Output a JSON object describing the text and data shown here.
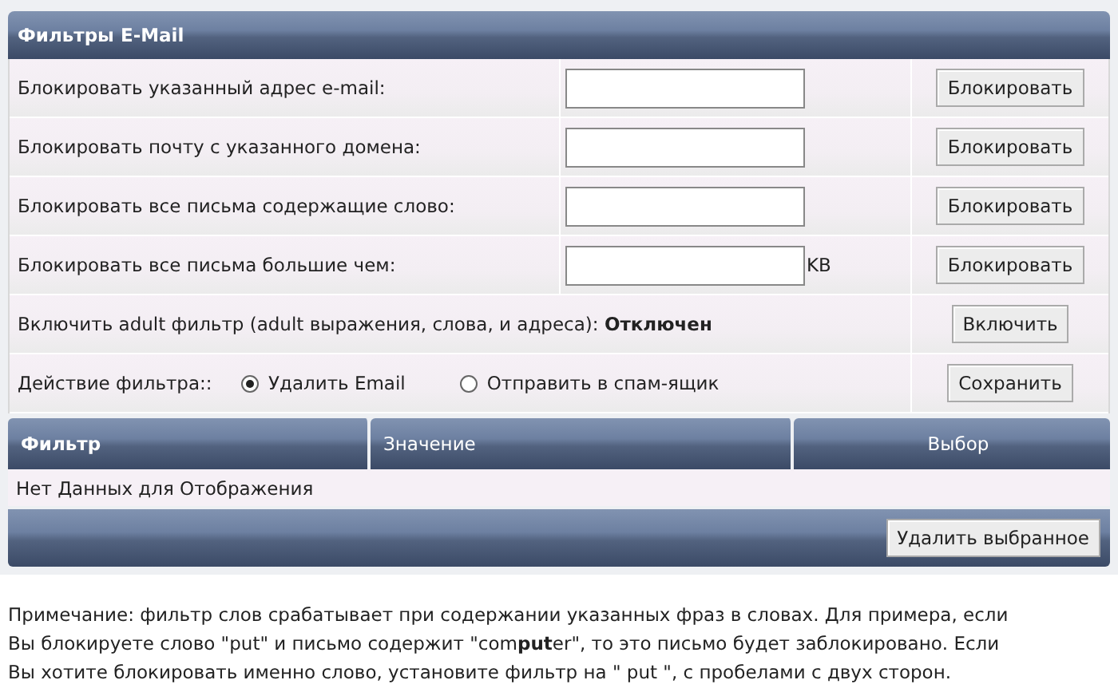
{
  "panel": {
    "title": "Фильтры E-Mail"
  },
  "rows": [
    {
      "kind": "input",
      "label": "Блокировать указанный адрес e-mail:",
      "button": "Блокировать"
    },
    {
      "kind": "input",
      "label": "Блокировать почту с указанного домена:",
      "button": "Блокировать"
    },
    {
      "kind": "input",
      "label": "Блокировать все письма содержащие слово:",
      "button": "Блокировать"
    },
    {
      "kind": "input",
      "label": "Блокировать все письма большие чем:",
      "unit": "KB",
      "button": "Блокировать"
    },
    {
      "kind": "status",
      "label": "Включить adult фильтр (adult выражения, слова, и адреса): **Отключен**",
      "button": "Включить"
    },
    {
      "kind": "radio",
      "label": "Действие фильтра::",
      "options": [
        {
          "label": "Удалить Email",
          "selected": true
        },
        {
          "label": "Отправить в спам-ящик",
          "selected": false
        }
      ],
      "button": "Сохранить"
    }
  ],
  "table": {
    "columns": [
      "Фильтр",
      "Значение",
      "Выбор"
    ],
    "empty_message": "Нет Данных для Отображения",
    "footer_button": "Удалить выбранное"
  },
  "note": "Примечание: фильтр слов срабатывает при содержании указанных фраз в словах. Для примера, если Вы блокируете слово \"put\" и письмо содержит \"com**put**er\", то это письмо будет заблокировано. Если Вы хотите блокировать именно слово, установите фильтр на \" put \", с пробелами с двух сторон."
}
